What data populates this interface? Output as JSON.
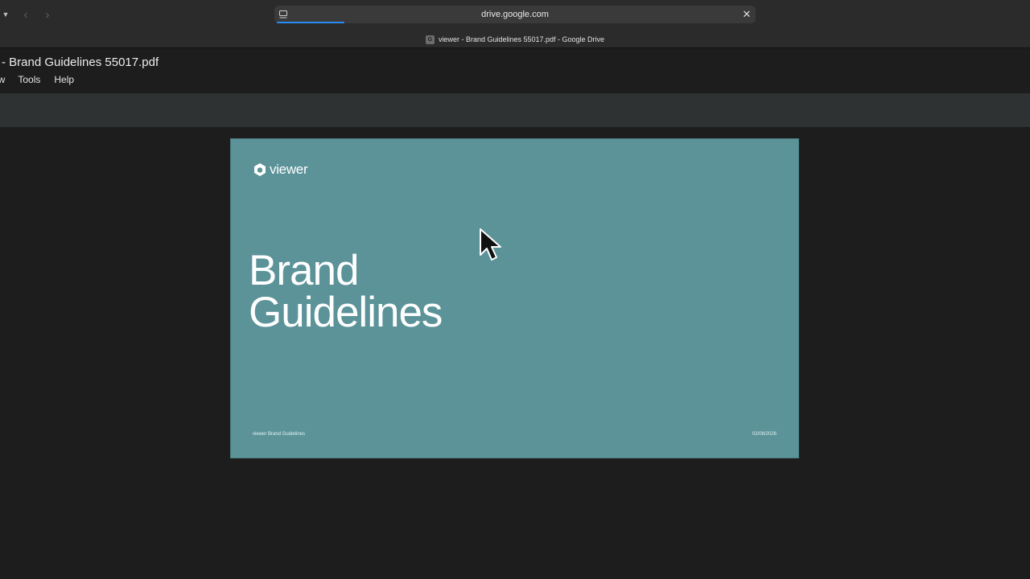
{
  "browser": {
    "url": "drive.google.com",
    "tab_title": "viewer - Brand Guidelines 55017.pdf - Google Drive",
    "favicon_letter": "G",
    "load_progress": 0.14
  },
  "app": {
    "doc_title": "- Brand Guidelines 55017.pdf",
    "menu": [
      "ew",
      "Tools",
      "Help"
    ]
  },
  "page": {
    "logo_text": "viewer",
    "heading_line1": "Brand",
    "heading_line2": "Guidelines",
    "footer_left": "viewer Brand Guidelines",
    "footer_right": "02/08/2026",
    "background_color": "#5b9399"
  },
  "icons": {
    "url_icon": "site-info-icon",
    "close": "close-icon",
    "back": "back-arrow-icon",
    "forward": "forward-arrow-icon",
    "cursor": "mouse-pointer-icon"
  }
}
